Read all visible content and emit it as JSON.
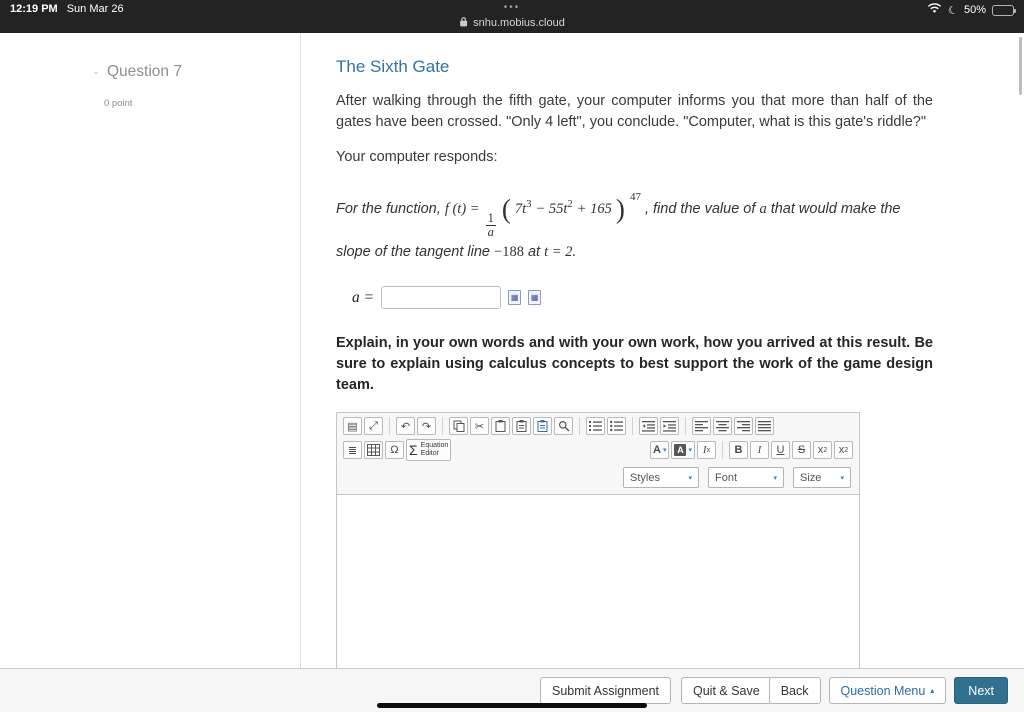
{
  "status_bar": {
    "time": "12:19 PM",
    "date": "Sun Mar 26",
    "battery_percent": "50%"
  },
  "browser": {
    "tab_dots": "•••",
    "url": "snhu.mobius.cloud"
  },
  "sidebar": {
    "dash": "-",
    "question_label": "Question 7",
    "points_label": "0 point"
  },
  "question": {
    "title": "The Sixth Gate",
    "paragraph1": "After walking through the fifth gate, your computer informs you that more than half of the gates have been crossed. \"Only 4 left\", you conclude. \"Computer, what is this gate's riddle?\"",
    "paragraph2": "Your computer responds:",
    "math": {
      "lead": "For the function, ",
      "func": "f (t) =",
      "frac_num": "1",
      "frac_den": "a",
      "paren_open": "(",
      "term1": "7t",
      "term1_exp": "3",
      "term2": " − 55t",
      "term2_exp": "2",
      "term3": " + 165",
      "paren_close": ")",
      "outer_exp": "47",
      "tail1": ", find the value of ",
      "var_a": "a",
      "tail2": " that would make the slope of the tangent line ",
      "value": "−188",
      "tail3": " at ",
      "eq": "t = 2.",
      "answer_label": "a ="
    },
    "explain": "Explain, in your own words and with your own work, how you arrived at this result. Be sure to explain using calculus concepts to best support the work of the game design team."
  },
  "editor": {
    "equation_button_line1": "Equation",
    "equation_button_line2": "Editor",
    "styles_label": "Styles",
    "font_label": "Font",
    "size_label": "Size"
  },
  "footer": {
    "submit_label": "Submit Assignment",
    "quit_label": "Quit & Save",
    "back_label": "Back",
    "menu_label": "Question Menu",
    "next_label": "Next"
  },
  "icons": {
    "caret_down": "▾",
    "caret_up": "▴",
    "source": "▤",
    "maximize": "⤢",
    "undo": "↶",
    "redo": "↷",
    "cut": "✂",
    "templates": "≣",
    "special_char": "Ω",
    "sigma": "Σ",
    "text_color": "A",
    "bg_color": "A",
    "remove_format_i": "I",
    "remove_format_x": "x",
    "bold": "B",
    "italic": "I",
    "underline": "U",
    "strike": "S",
    "sub_base": "x",
    "sub_small": "2",
    "sup_base": "x",
    "sup_small": "2",
    "answer_keyboard": "▦",
    "answer_preview": "▦",
    "moon": "☾",
    "wifi": "wifi-svg-shape",
    "battery": "battery-css-shape",
    "lock": "lock-svg-shape"
  },
  "colors": {
    "accent_blue": "#2e74a8",
    "next_button": "#31708f",
    "battery_low_power": "#ffd426"
  }
}
